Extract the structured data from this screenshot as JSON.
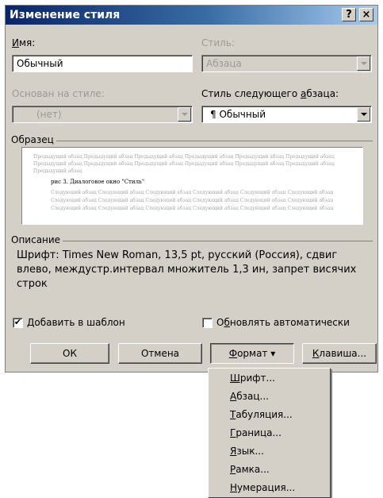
{
  "dialog": {
    "title": "Изменение стиля",
    "help_glyph": "?",
    "close_glyph": "×"
  },
  "name": {
    "label_u": "И",
    "label_rest": "мя:",
    "value": "Обычный"
  },
  "style": {
    "label": "Стиль:",
    "value": "Абзаца"
  },
  "based_on": {
    "label": "Основан на стиле:",
    "value": "(нет)"
  },
  "next_style": {
    "label_a": "Стиль следующего ",
    "label_u": "а",
    "label_b": "бзаца:",
    "marker": "¶",
    "value": "Обычный"
  },
  "sample": {
    "label": "Образец",
    "prev_lines": [
      "Предыдущий абзац Предыдущий абзац Предыдущий абзац Предыдущий абзац Предыдущий абзац Предыдущий абзац",
      "Предыдущий абзац Предыдущий абзац Предыдущий абзац Предыдущий абзац Предыдущий абзац Предыдущий абзац",
      "Предыдущий абзац"
    ],
    "main_line": "рис 3. Диалоговое окно \"Стиль\"",
    "next_lines": [
      "Следующий абзац Следующий абзац Следующий абзац Следующий абзац Следующий абзац Следующий абзац",
      "Следующий абзац Следующий абзац Следующий абзац Следующий абзац Следующий абзац Следующий абзац",
      "Следующий абзац Следующий абзац Следующий абзац Следующий абзац Следующий абзац Следующий абзац"
    ]
  },
  "description": {
    "label": "Описание",
    "text": "Шрифт: Times New Roman, 13,5 pt, русский (Россия), сдвиг влево, междустр.интервал множитель 1,3 ин, запрет висячих строк"
  },
  "checkboxes": {
    "add_to_template": {
      "check": "✔",
      "label_u": "Д",
      "label_rest": "обавить в шаблон"
    },
    "auto_update": {
      "label_a": "О",
      "label_u": "б",
      "label_rest": "новлять автоматически"
    }
  },
  "buttons": {
    "ok": "ОК",
    "cancel": "Отмена",
    "format_u": "Ф",
    "format_rest": "ормат",
    "format_arrow": "▾",
    "shortcut_u": "К",
    "shortcut_rest": "лавиша..."
  },
  "format_menu": {
    "items": [
      {
        "u": "Ш",
        "rest": "рифт..."
      },
      {
        "u": "А",
        "rest": "бзац..."
      },
      {
        "u": "Т",
        "rest": "абуляция..."
      },
      {
        "u": "Г",
        "rest": "раница..."
      },
      {
        "u": "Я",
        "rest": "зык..."
      },
      {
        "u": "Р",
        "rest": "амка..."
      },
      {
        "u": "Н",
        "rest": "умерация..."
      }
    ]
  }
}
